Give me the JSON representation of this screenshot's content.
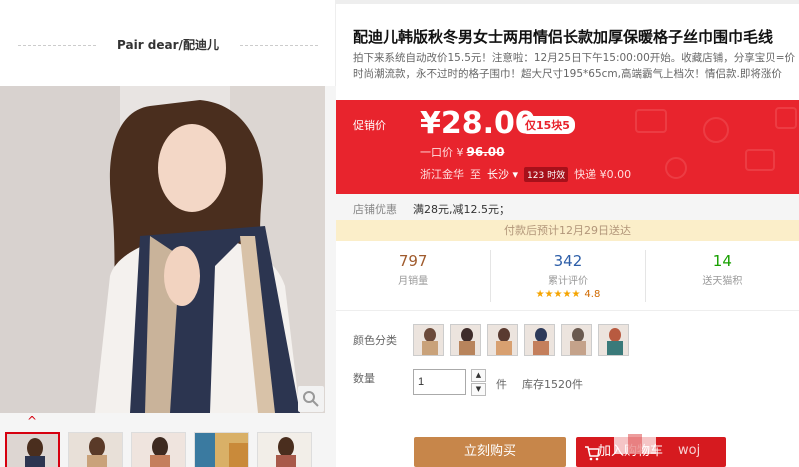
{
  "shop": {
    "name": "Pair dear/配迪儿"
  },
  "product": {
    "title": "配迪儿韩版秋冬男女士两用情侣长款加厚保暖格子丝巾围巾毛线",
    "desc_line1": "拍下来系统自动改价15.5元！注意啦：12月25日下午15:00:00开始。收藏店铺，分享宝贝=价",
    "desc_line2": "时尚潮流款，永不过时的格子围巾！超大尺寸195*65cm,高端霸气上档次！情侣款.即将涨价"
  },
  "price_box": {
    "promo_label": "促销价",
    "price": "¥28.00",
    "badge": "仅15块5",
    "orig_label": "一口价 ¥",
    "orig_price": "96.00",
    "from": "浙江金华",
    "to_word": "至",
    "dest": "长沙 ▾",
    "timing_tag": "123 时效",
    "express": "快递 ¥0.00"
  },
  "store_promo": {
    "label": "店铺优惠",
    "value": "满28元,减12.5元；"
  },
  "delivery_note": "付款后预计12月29日送达",
  "stats": {
    "monthly_sales": "797",
    "monthly_sales_label": "月销量",
    "reviews": "342",
    "reviews_label": "累计评价",
    "rating": "4.8",
    "stars": "★★★★★",
    "points": "14",
    "points_label": "送天猫积"
  },
  "color_label": "颜色分类",
  "swatches": [
    {
      "colors": [
        "#c9a27a",
        "#6b4a3a"
      ]
    },
    {
      "colors": [
        "#b8845c",
        "#3e2c2a"
      ]
    },
    {
      "colors": [
        "#d8a070",
        "#5a3a30"
      ]
    },
    {
      "colors": [
        "#c47f5c",
        "#2d3a5a"
      ]
    },
    {
      "colors": [
        "#c4a28a",
        "#6a5a50"
      ]
    },
    {
      "colors": [
        "#3a7a7a",
        "#b85a40"
      ]
    }
  ],
  "quantity": {
    "label": "数量",
    "value": "1",
    "unit": "件",
    "stock": "库存1520件"
  },
  "buttons": {
    "buy": "立刻购买",
    "cart": "加入购物车"
  },
  "watermark": {
    "text": "08收家",
    "sub": "woj"
  },
  "colors": {
    "accent_red": "#e8242d",
    "buy_brown": "#c7864a",
    "cart_red": "#d61a1f"
  }
}
